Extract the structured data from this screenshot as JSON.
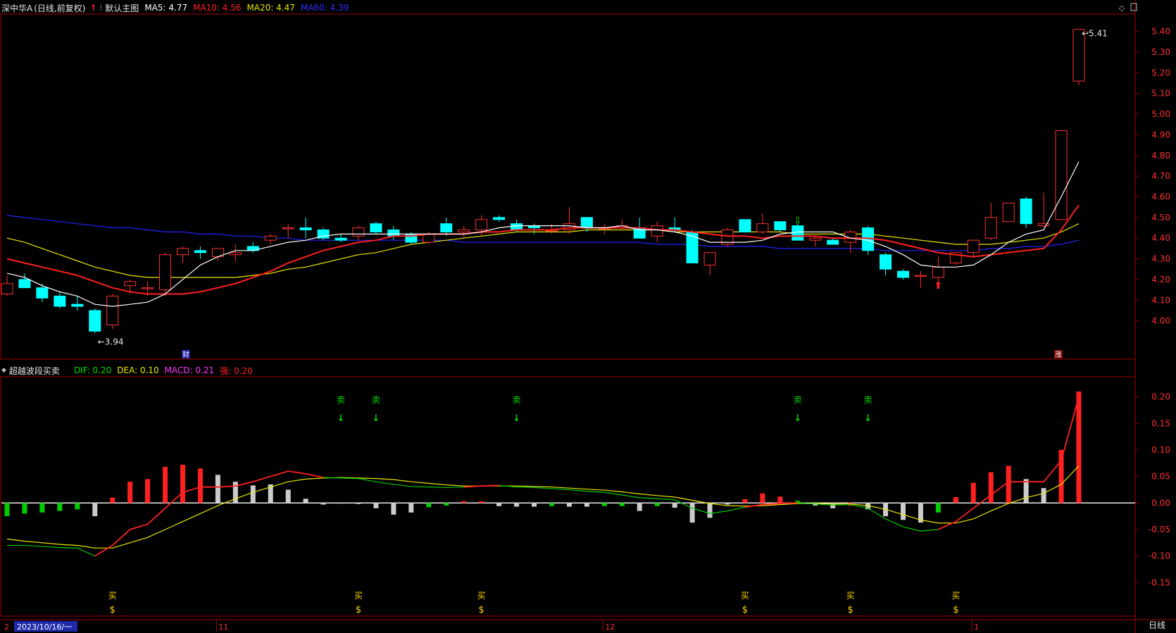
{
  "header": {
    "stock_name": "深中华A",
    "period_label": "(日线,前复权)",
    "chart_name": "默认主图",
    "ma5_label": "MA5: 4.77",
    "ma10_label": "MA10: 4.56",
    "ma20_label": "MA20: 4.47",
    "ma60_label": "MA60: 4.39"
  },
  "sub_header": {
    "indicator_name": "超越波段买卖",
    "dif_label": "DIF: 0.20",
    "dea_label": "DEA: 0.10",
    "macd_label": "MACD: 0.21",
    "strong_label": "强: 0.20"
  },
  "price_axis": [
    "5.40",
    "5.30",
    "5.20",
    "5.10",
    "5.00",
    "4.90",
    "4.80",
    "4.70",
    "4.60",
    "4.50",
    "4.40",
    "4.30",
    "4.20",
    "4.10",
    "4.00"
  ],
  "macd_axis": [
    "0.20",
    "0.15",
    "0.10",
    "0.05",
    "0.00",
    "-0.05",
    "-0.10",
    "-0.15"
  ],
  "markers": {
    "low_label": "3.94",
    "high_label": "5.41",
    "finance_badge": "财",
    "limit_up_badge": "涨",
    "buy_label": "买",
    "sell_label": "卖"
  },
  "date_axis": {
    "selected_date": "2023/10/16/一",
    "left_stub": "2",
    "month_labels": [
      "11",
      "12",
      "1"
    ],
    "period_button": "日线"
  },
  "colors": {
    "up": "#ff3232",
    "down": "#00ffff",
    "ma5": "#ffffff",
    "ma10": "#ff2020",
    "ma20": "#e8e800",
    "ma60": "#2222ff",
    "dif_up": "#ff2020",
    "dif_down": "#00cc00",
    "dea": "#e8e800",
    "hist_up": "#ff2020",
    "hist_down": "#00cc00",
    "hist_weak": "#cccccc",
    "buy_text": "#ffd700",
    "sell_text": "#00dd00",
    "frame": "#a00000"
  },
  "chart_data": [
    {
      "type": "candlestick",
      "title": "深中华A (日线,前复权)",
      "ylim": [
        3.9,
        5.45
      ],
      "series_names": [
        "MA5",
        "MA10",
        "MA20",
        "MA60"
      ],
      "candles": [
        {
          "o": 4.13,
          "h": 4.22,
          "l": 4.12,
          "c": 4.18
        },
        {
          "o": 4.2,
          "h": 4.23,
          "l": 4.16,
          "c": 4.16
        },
        {
          "o": 4.16,
          "h": 4.18,
          "l": 4.09,
          "c": 4.11
        },
        {
          "o": 4.12,
          "h": 4.14,
          "l": 4.06,
          "c": 4.07
        },
        {
          "o": 4.08,
          "h": 4.12,
          "l": 4.05,
          "c": 4.07
        },
        {
          "o": 4.05,
          "h": 4.06,
          "l": 3.94,
          "c": 3.95
        },
        {
          "o": 3.98,
          "h": 4.13,
          "l": 3.96,
          "c": 4.12
        },
        {
          "o": 4.17,
          "h": 4.2,
          "l": 4.13,
          "c": 4.19
        },
        {
          "o": 4.16,
          "h": 4.19,
          "l": 4.12,
          "c": 4.16
        },
        {
          "o": 4.15,
          "h": 4.33,
          "l": 4.12,
          "c": 4.32
        },
        {
          "o": 4.32,
          "h": 4.36,
          "l": 4.28,
          "c": 4.35
        },
        {
          "o": 4.34,
          "h": 4.36,
          "l": 4.3,
          "c": 4.33
        },
        {
          "o": 4.31,
          "h": 4.35,
          "l": 4.29,
          "c": 4.35
        },
        {
          "o": 4.32,
          "h": 4.37,
          "l": 4.29,
          "c": 4.33
        },
        {
          "o": 4.36,
          "h": 4.38,
          "l": 4.33,
          "c": 4.34
        },
        {
          "o": 4.39,
          "h": 4.42,
          "l": 4.37,
          "c": 4.41
        },
        {
          "o": 4.45,
          "h": 4.47,
          "l": 4.4,
          "c": 4.45
        },
        {
          "o": 4.45,
          "h": 4.5,
          "l": 4.4,
          "c": 4.44
        },
        {
          "o": 4.44,
          "h": 4.45,
          "l": 4.39,
          "c": 4.4
        },
        {
          "o": 4.4,
          "h": 4.42,
          "l": 4.38,
          "c": 4.39
        },
        {
          "o": 4.41,
          "h": 4.46,
          "l": 4.39,
          "c": 4.45
        },
        {
          "o": 4.47,
          "h": 4.48,
          "l": 4.42,
          "c": 4.43
        },
        {
          "o": 4.44,
          "h": 4.46,
          "l": 4.39,
          "c": 4.41
        },
        {
          "o": 4.42,
          "h": 4.43,
          "l": 4.37,
          "c": 4.38
        },
        {
          "o": 4.38,
          "h": 4.43,
          "l": 4.37,
          "c": 4.42
        },
        {
          "o": 4.47,
          "h": 4.5,
          "l": 4.41,
          "c": 4.43
        },
        {
          "o": 4.43,
          "h": 4.46,
          "l": 4.4,
          "c": 4.44
        },
        {
          "o": 4.44,
          "h": 4.51,
          "l": 4.41,
          "c": 4.49
        },
        {
          "o": 4.5,
          "h": 4.51,
          "l": 4.48,
          "c": 4.49
        },
        {
          "o": 4.47,
          "h": 4.49,
          "l": 4.43,
          "c": 4.44
        },
        {
          "o": 4.46,
          "h": 4.47,
          "l": 4.42,
          "c": 4.45
        },
        {
          "o": 4.44,
          "h": 4.47,
          "l": 4.42,
          "c": 4.44
        },
        {
          "o": 4.44,
          "h": 4.55,
          "l": 4.42,
          "c": 4.47
        },
        {
          "o": 4.5,
          "h": 4.5,
          "l": 4.43,
          "c": 4.45
        },
        {
          "o": 4.45,
          "h": 4.47,
          "l": 4.42,
          "c": 4.45
        },
        {
          "o": 4.45,
          "h": 4.49,
          "l": 4.44,
          "c": 4.46
        },
        {
          "o": 4.45,
          "h": 4.5,
          "l": 4.42,
          "c": 4.4
        },
        {
          "o": 4.41,
          "h": 4.48,
          "l": 4.38,
          "c": 4.46
        },
        {
          "o": 4.45,
          "h": 4.5,
          "l": 4.43,
          "c": 4.44
        },
        {
          "o": 4.43,
          "h": 4.44,
          "l": 4.28,
          "c": 4.28
        },
        {
          "o": 4.27,
          "h": 4.33,
          "l": 4.22,
          "c": 4.33
        },
        {
          "o": 4.37,
          "h": 4.45,
          "l": 4.36,
          "c": 4.44
        },
        {
          "o": 4.49,
          "h": 4.49,
          "l": 4.43,
          "c": 4.43
        },
        {
          "o": 4.43,
          "h": 4.52,
          "l": 4.42,
          "c": 4.47
        },
        {
          "o": 4.48,
          "h": 4.48,
          "l": 4.43,
          "c": 4.44
        },
        {
          "o": 4.46,
          "h": 4.47,
          "l": 4.39,
          "c": 4.39
        },
        {
          "o": 4.39,
          "h": 4.41,
          "l": 4.36,
          "c": 4.4
        },
        {
          "o": 4.39,
          "h": 4.4,
          "l": 4.37,
          "c": 4.37
        },
        {
          "o": 4.38,
          "h": 4.44,
          "l": 4.33,
          "c": 4.43
        },
        {
          "o": 4.45,
          "h": 4.46,
          "l": 4.32,
          "c": 4.34
        },
        {
          "o": 4.32,
          "h": 4.33,
          "l": 4.22,
          "c": 4.25
        },
        {
          "o": 4.24,
          "h": 4.25,
          "l": 4.2,
          "c": 4.21
        },
        {
          "o": 4.22,
          "h": 4.24,
          "l": 4.16,
          "c": 4.22
        },
        {
          "o": 4.21,
          "h": 4.31,
          "l": 4.19,
          "c": 4.26
        },
        {
          "o": 4.28,
          "h": 4.32,
          "l": 4.27,
          "c": 4.33
        },
        {
          "o": 4.33,
          "h": 4.38,
          "l": 4.31,
          "c": 4.39
        },
        {
          "o": 4.4,
          "h": 4.57,
          "l": 4.39,
          "c": 4.5
        },
        {
          "o": 4.48,
          "h": 4.57,
          "l": 4.48,
          "c": 4.57
        },
        {
          "o": 4.59,
          "h": 4.6,
          "l": 4.45,
          "c": 4.47
        },
        {
          "o": 4.46,
          "h": 4.62,
          "l": 4.45,
          "c": 4.47
        },
        {
          "o": 4.49,
          "h": 4.92,
          "l": 4.49,
          "c": 4.92
        },
        {
          "o": 5.16,
          "h": 5.41,
          "l": 5.14,
          "c": 5.41
        }
      ],
      "ma5": [
        4.23,
        4.21,
        4.17,
        4.14,
        4.12,
        4.08,
        4.07,
        4.08,
        4.09,
        4.13,
        4.2,
        4.27,
        4.31,
        4.34,
        4.34,
        4.36,
        4.38,
        4.39,
        4.41,
        4.42,
        4.42,
        4.42,
        4.42,
        4.42,
        4.42,
        4.42,
        4.42,
        4.43,
        4.45,
        4.46,
        4.46,
        4.46,
        4.46,
        4.45,
        4.45,
        4.46,
        4.44,
        4.44,
        4.43,
        4.41,
        4.38,
        4.38,
        4.38,
        4.39,
        4.42,
        4.43,
        4.43,
        4.43,
        4.4,
        4.39,
        4.36,
        4.32,
        4.27,
        4.26,
        4.26,
        4.27,
        4.32,
        4.38,
        4.42,
        4.44,
        4.6,
        4.77
      ],
      "ma10": [
        4.3,
        4.28,
        4.26,
        4.24,
        4.22,
        4.19,
        4.16,
        4.14,
        4.13,
        4.13,
        4.13,
        4.14,
        4.16,
        4.18,
        4.21,
        4.24,
        4.28,
        4.31,
        4.34,
        4.36,
        4.38,
        4.39,
        4.41,
        4.41,
        4.42,
        4.42,
        4.42,
        4.43,
        4.43,
        4.44,
        4.44,
        4.44,
        4.45,
        4.45,
        4.45,
        4.45,
        4.45,
        4.44,
        4.44,
        4.43,
        4.42,
        4.41,
        4.41,
        4.4,
        4.41,
        4.41,
        4.41,
        4.4,
        4.4,
        4.4,
        4.39,
        4.37,
        4.35,
        4.33,
        4.32,
        4.31,
        4.32,
        4.33,
        4.34,
        4.35,
        4.44,
        4.56
      ],
      "ma20": [
        4.4,
        4.38,
        4.35,
        4.32,
        4.29,
        4.26,
        4.24,
        4.22,
        4.21,
        4.21,
        4.21,
        4.21,
        4.21,
        4.21,
        4.22,
        4.23,
        4.25,
        4.26,
        4.28,
        4.3,
        4.32,
        4.33,
        4.35,
        4.37,
        4.38,
        4.39,
        4.4,
        4.41,
        4.42,
        4.43,
        4.43,
        4.43,
        4.43,
        4.44,
        4.44,
        4.44,
        4.44,
        4.44,
        4.43,
        4.43,
        4.43,
        4.43,
        4.43,
        4.43,
        4.43,
        4.42,
        4.42,
        4.42,
        4.42,
        4.42,
        4.41,
        4.4,
        4.39,
        4.38,
        4.37,
        4.37,
        4.37,
        4.38,
        4.39,
        4.4,
        4.43,
        4.47
      ],
      "ma60": [
        4.51,
        4.5,
        4.49,
        4.48,
        4.47,
        4.46,
        4.45,
        4.45,
        4.44,
        4.43,
        4.43,
        4.42,
        4.42,
        4.41,
        4.41,
        4.4,
        4.4,
        4.39,
        4.39,
        4.39,
        4.39,
        4.39,
        4.39,
        4.39,
        4.39,
        4.39,
        4.38,
        4.38,
        4.38,
        4.38,
        4.38,
        4.38,
        4.38,
        4.38,
        4.38,
        4.38,
        4.38,
        4.37,
        4.37,
        4.37,
        4.36,
        4.36,
        4.36,
        4.36,
        4.35,
        4.35,
        4.35,
        4.35,
        4.35,
        4.35,
        4.34,
        4.34,
        4.34,
        4.34,
        4.34,
        4.34,
        4.35,
        4.35,
        4.36,
        4.36,
        4.37,
        4.39
      ]
    },
    {
      "type": "bar",
      "title": "超越波段买卖",
      "ylim": [
        -0.2,
        0.23
      ],
      "series_names": [
        "DIF",
        "DEA",
        "MACD"
      ],
      "macd": [
        -0.025,
        -0.02,
        -0.018,
        -0.015,
        -0.012,
        -0.025,
        0.01,
        0.04,
        0.045,
        0.068,
        0.072,
        0.065,
        0.053,
        0.04,
        0.033,
        0.035,
        0.025,
        0.008,
        -0.003,
        0.0,
        -0.002,
        -0.01,
        -0.022,
        -0.018,
        -0.008,
        -0.005,
        0.003,
        0.003,
        -0.006,
        -0.007,
        -0.007,
        -0.006,
        -0.007,
        -0.007,
        -0.006,
        -0.006,
        -0.015,
        -0.006,
        -0.009,
        -0.037,
        -0.028,
        -0.003,
        0.007,
        0.018,
        0.012,
        0.004,
        -0.005,
        -0.01,
        -0.005,
        -0.012,
        -0.025,
        -0.032,
        -0.037,
        -0.018,
        0.011,
        0.038,
        0.058,
        0.07,
        0.045,
        0.028,
        0.1,
        0.21
      ],
      "hist_color": [
        "d",
        "d",
        "d",
        "d",
        "d",
        "w",
        "u",
        "u",
        "u",
        "u",
        "u",
        "u",
        "w",
        "w",
        "w",
        "w",
        "w",
        "w",
        "w",
        "w",
        "w",
        "w",
        "w",
        "w",
        "d",
        "d",
        "u",
        "u",
        "w",
        "w",
        "w",
        "d",
        "w",
        "w",
        "d",
        "d",
        "w",
        "d",
        "w",
        "w",
        "w",
        "w",
        "u",
        "u",
        "u",
        "d",
        "w",
        "w",
        "u",
        "w",
        "w",
        "w",
        "w",
        "d",
        "u",
        "u",
        "u",
        "u",
        "w",
        "w",
        "u",
        "u"
      ],
      "dif": [
        -0.08,
        -0.08,
        -0.082,
        -0.084,
        -0.085,
        -0.1,
        -0.08,
        -0.05,
        -0.04,
        -0.01,
        0.02,
        0.03,
        0.03,
        0.032,
        0.04,
        0.05,
        0.06,
        0.055,
        0.048,
        0.047,
        0.046,
        0.04,
        0.035,
        0.031,
        0.03,
        0.029,
        0.03,
        0.032,
        0.033,
        0.03,
        0.029,
        0.027,
        0.025,
        0.022,
        0.02,
        0.015,
        0.01,
        0.008,
        0.006,
        -0.01,
        -0.02,
        -0.015,
        -0.008,
        -0.003,
        -0.001,
        0.0,
        -0.002,
        -0.004,
        -0.003,
        -0.01,
        -0.03,
        -0.045,
        -0.053,
        -0.05,
        -0.035,
        -0.01,
        0.015,
        0.04,
        0.04,
        0.04,
        0.08,
        0.2
      ],
      "dea": [
        -0.068,
        -0.072,
        -0.075,
        -0.078,
        -0.08,
        -0.085,
        -0.085,
        -0.075,
        -0.065,
        -0.05,
        -0.035,
        -0.02,
        -0.005,
        0.008,
        0.02,
        0.03,
        0.04,
        0.045,
        0.047,
        0.048,
        0.047,
        0.046,
        0.044,
        0.04,
        0.037,
        0.034,
        0.032,
        0.032,
        0.032,
        0.032,
        0.031,
        0.03,
        0.028,
        0.026,
        0.024,
        0.021,
        0.017,
        0.014,
        0.011,
        0.005,
        -0.001,
        -0.005,
        -0.006,
        -0.005,
        -0.003,
        -0.001,
        -0.001,
        -0.002,
        -0.002,
        -0.005,
        -0.012,
        -0.022,
        -0.032,
        -0.038,
        -0.038,
        -0.03,
        -0.015,
        -0.001,
        0.01,
        0.018,
        0.035,
        0.07
      ],
      "buy_signal_indices": [
        6,
        20,
        27,
        42,
        48,
        54
      ],
      "sell_signal_indices": [
        19,
        21,
        29,
        45,
        49
      ]
    }
  ]
}
